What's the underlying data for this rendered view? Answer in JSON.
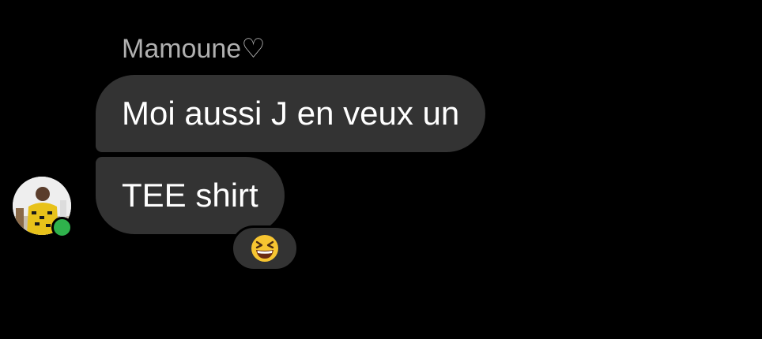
{
  "message_group": {
    "sender_name": "Mamoune♡",
    "messages": [
      {
        "text": "Moi aussi J en veux un"
      },
      {
        "text": "TEE shirt"
      }
    ],
    "reaction": {
      "emoji": "😆"
    }
  },
  "avatar": {
    "icon": "user-avatar",
    "online": true
  },
  "colors": {
    "background": "#000000",
    "bubble": "#333333",
    "message_text": "#ffffff",
    "sender_name": "#b0b0b0",
    "online_indicator": "#2fb24c"
  }
}
